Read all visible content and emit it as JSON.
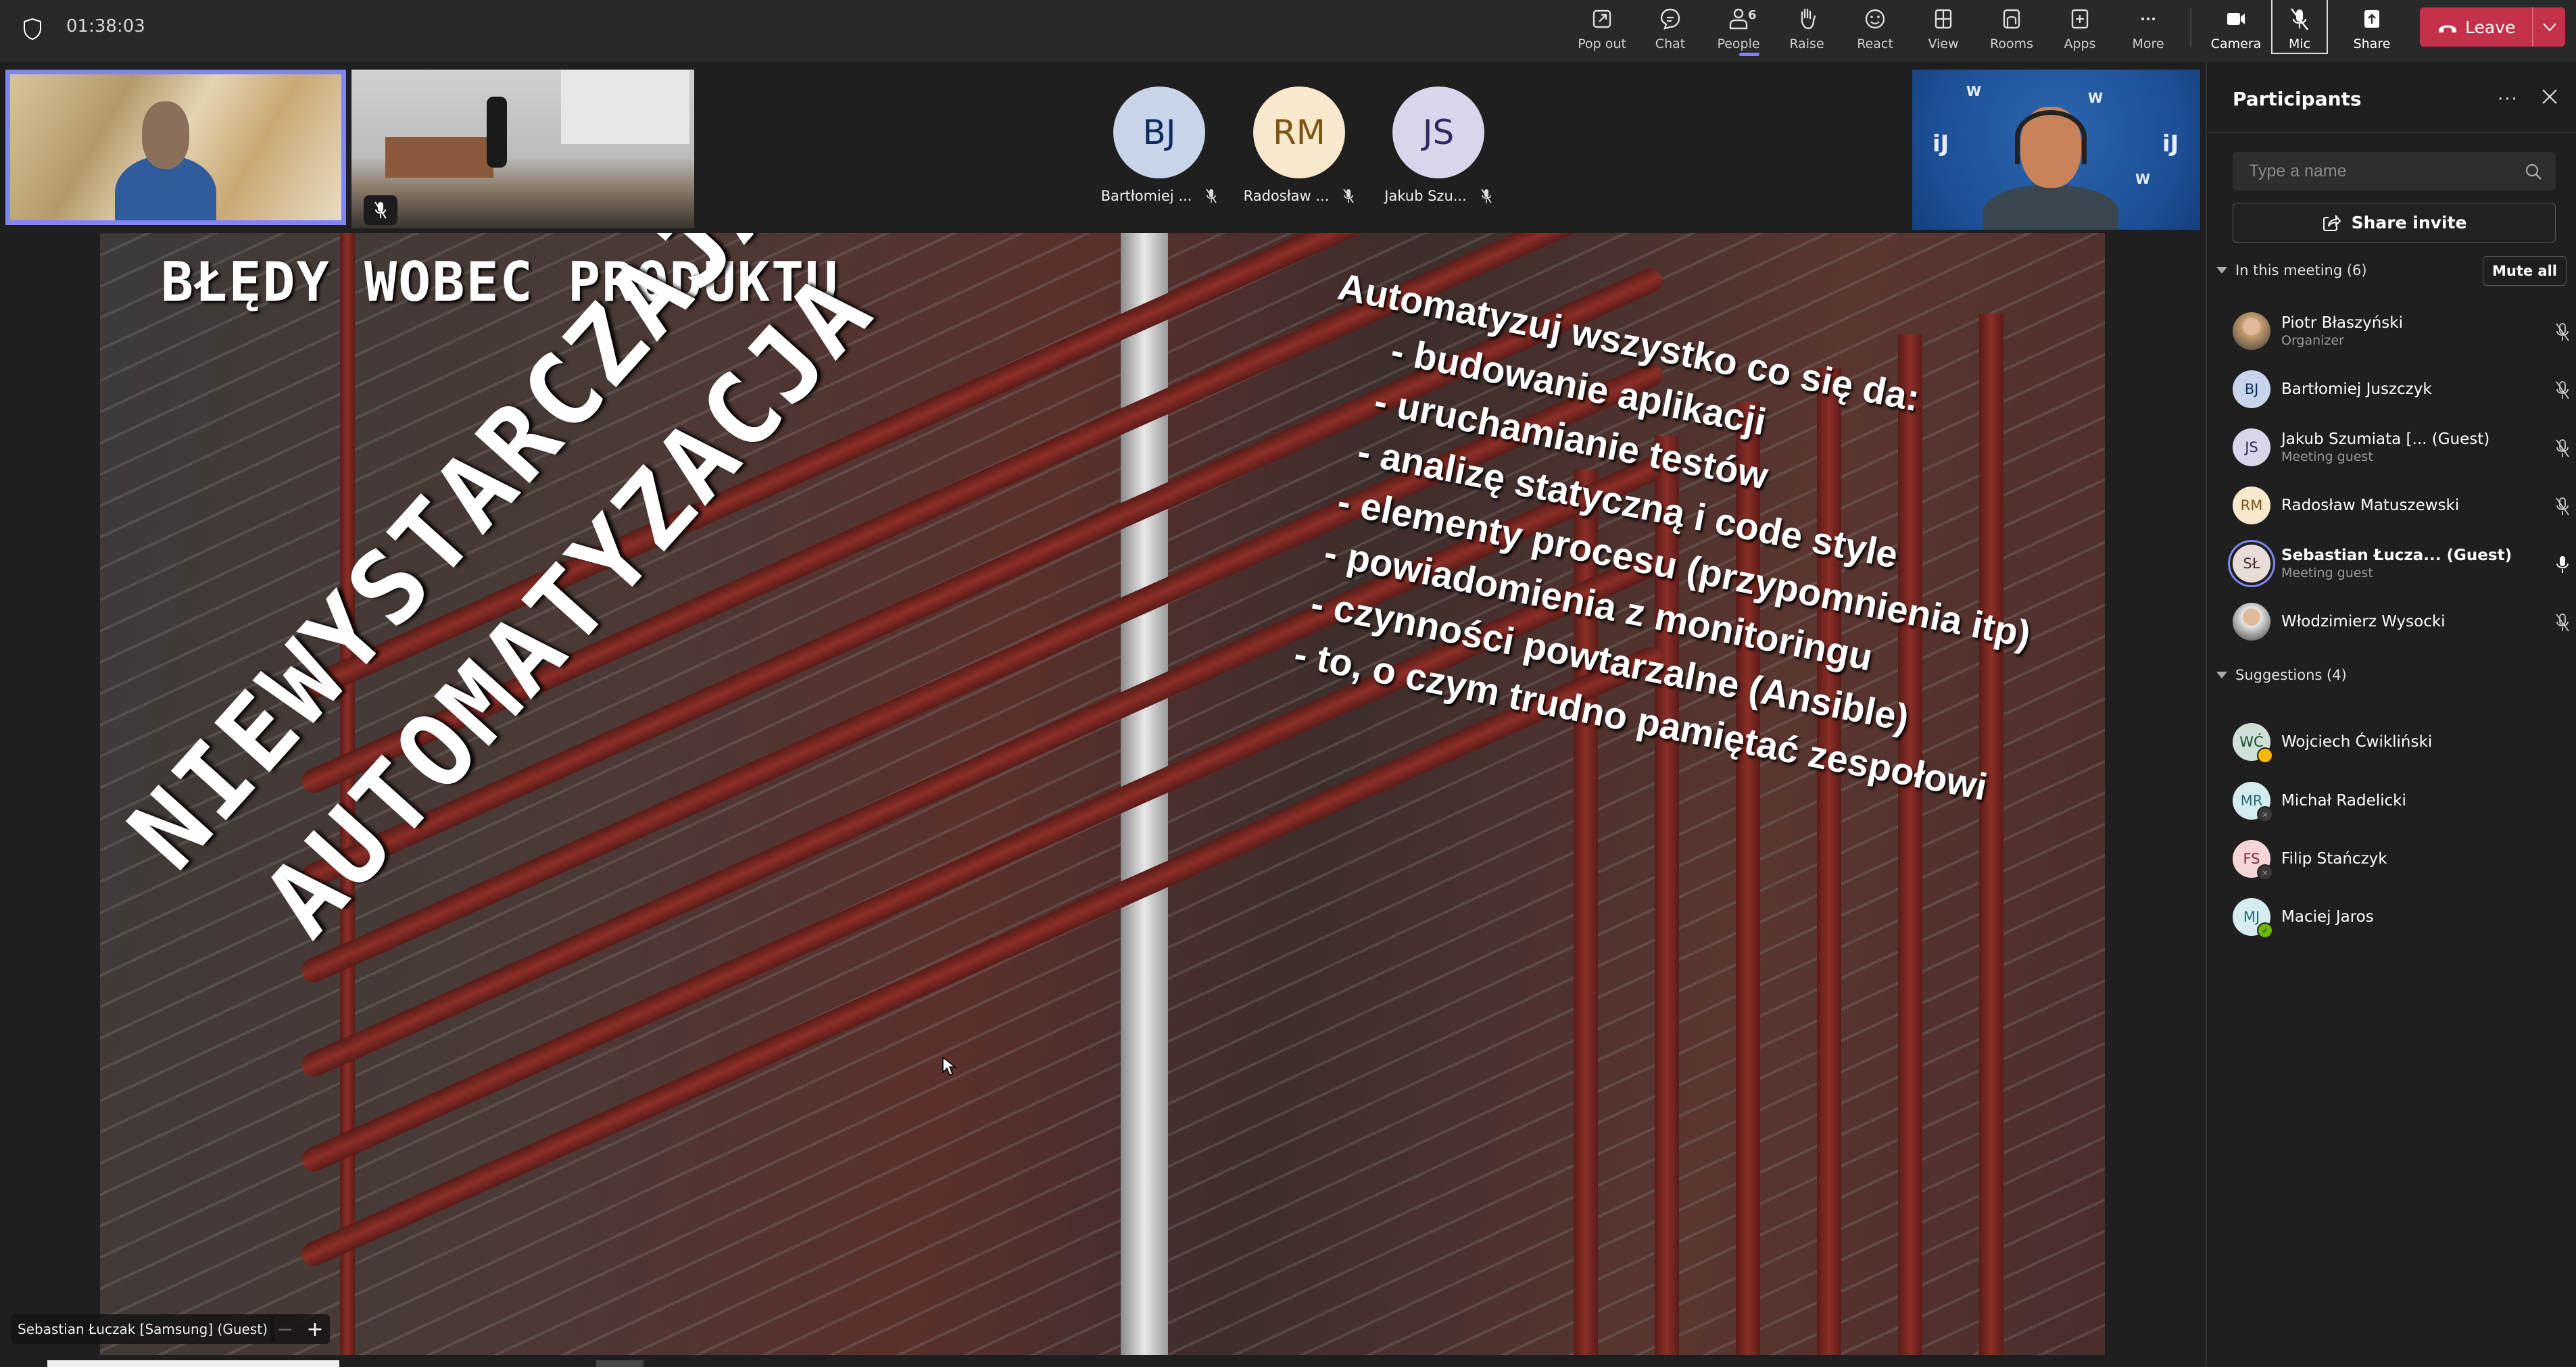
{
  "topbar": {
    "timer": "01:38:03",
    "buttons": [
      {
        "id": "popout",
        "label": "Pop out",
        "icon": "pop-out-icon"
      },
      {
        "id": "chat",
        "label": "Chat",
        "icon": "chat-icon"
      },
      {
        "id": "people",
        "label": "People",
        "icon": "people-icon",
        "count": "6",
        "active": true
      },
      {
        "id": "raise",
        "label": "Raise",
        "icon": "raise-hand-icon"
      },
      {
        "id": "react",
        "label": "React",
        "icon": "react-smiley-icon"
      },
      {
        "id": "view",
        "label": "View",
        "icon": "view-grid-icon"
      },
      {
        "id": "rooms",
        "label": "Rooms",
        "icon": "rooms-icon"
      },
      {
        "id": "apps",
        "label": "Apps",
        "icon": "apps-plus-icon"
      },
      {
        "id": "more",
        "label": "More",
        "icon": "more-ellipsis-icon"
      },
      {
        "id": "camera",
        "label": "Camera",
        "icon": "camera-icon"
      },
      {
        "id": "mic",
        "label": "Mic",
        "icon": "mic-off-icon",
        "muted": true
      },
      {
        "id": "share",
        "label": "Share",
        "icon": "share-screen-icon"
      }
    ],
    "leave_label": "Leave",
    "leave_color": "#c4314b",
    "accent_color": "#7f85f5"
  },
  "gallery": {
    "audio_only": [
      {
        "initials": "BJ",
        "name": "Bartłomiej ...",
        "bg": "#c7d4ea",
        "fg": "#0e2a5c",
        "muted": true
      },
      {
        "initials": "RM",
        "name": "Radosław ...",
        "bg": "#f8e9cc",
        "fg": "#7a5515",
        "muted": true
      },
      {
        "initials": "JS",
        "name": "Jakub Szu...",
        "bg": "#d8d6ea",
        "fg": "#2d2a63",
        "muted": true
      }
    ]
  },
  "slide": {
    "title": "BŁĘDY WOBEC PRODUKTU",
    "diagonal_line1": "NIEWYSTARCZAJĄCA",
    "diagonal_line2": "AUTOMATYZACJA",
    "bullets": [
      "Automatyzuj wszystko co się da:",
      "- budowanie aplikacji",
      "- uruchamianie testów",
      "- analizę statyczną i code style",
      "- elementy procesu (przypomnienia itp)",
      "- powiadomienia z monitoringu",
      "- czynności powtarzalne (Ansible)",
      "- to, o czym trudno pamiętać zespołowi"
    ],
    "presenter_label": "Sebastian Łuczak [Samsung] (Guest)",
    "zoom_out": "−",
    "zoom_in": "+"
  },
  "panel": {
    "title": "Participants",
    "search_placeholder": "Type a name",
    "share_invite_label": "Share invite",
    "in_meeting_label": "In this meeting (6)",
    "mute_all_label": "Mute all",
    "in_meeting": [
      {
        "name": "Piotr Błaszyński",
        "sub": "Organizer",
        "photo": true,
        "bg": "#c8a070",
        "mic": "off"
      },
      {
        "name": "Bartłomiej Juszczyk",
        "sub": "",
        "initials": "BJ",
        "bg": "#c7d4ea",
        "fg": "#0e2a5c",
        "mic": "off"
      },
      {
        "name": "Jakub Szumiata [... (Guest)",
        "sub": "Meeting guest",
        "initials": "JS",
        "bg": "#d8d6ea",
        "fg": "#2d2a63",
        "mic": "off"
      },
      {
        "name": "Radosław Matuszewski",
        "sub": "",
        "initials": "RM",
        "bg": "#f8e9cc",
        "fg": "#7a5515",
        "mic": "off"
      },
      {
        "name": "Sebastian Łucza...  (Guest)",
        "sub": "Meeting guest",
        "initials": "SŁ",
        "bg": "#e8dcd8",
        "fg": "#4a2e26",
        "mic": "on",
        "speaking": true
      },
      {
        "name": "Włodzimierz Wysocki",
        "sub": "",
        "photo": true,
        "bg": "#e8e8e8",
        "mic": "off"
      }
    ],
    "suggestions_label": "Suggestions (4)",
    "suggestions": [
      {
        "name": "Wojciech Ćwikliński",
        "initials": "WĆ",
        "bg": "#cfe0d6",
        "fg": "#1d4a33",
        "status": "away",
        "status_color": "#f8b600"
      },
      {
        "name": "Michał Radelicki",
        "initials": "MR",
        "bg": "#d6edf0",
        "fg": "#2a6a70",
        "status": "offline",
        "status_color": "#8a8a8a"
      },
      {
        "name": "Filip Stańczyk",
        "initials": "FS",
        "bg": "#f4d6d9",
        "fg": "#7a2a38",
        "status": "offline",
        "status_color": "#8a8a8a"
      },
      {
        "name": "Maciej Jaros",
        "initials": "MJ",
        "bg": "#d6edf0",
        "fg": "#2a6a70",
        "status": "available",
        "status_color": "#6bb700"
      }
    ]
  }
}
